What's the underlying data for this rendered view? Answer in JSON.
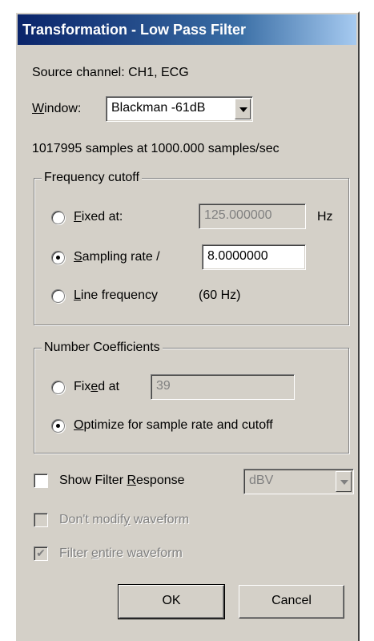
{
  "window": {
    "title": "Transformation - Low Pass Filter"
  },
  "source": {
    "label": "Source channel:",
    "value": "CH1, ECG"
  },
  "window_select": {
    "label_prefix": "",
    "label_ul": "W",
    "label_rest": "indow:",
    "value": "Blackman -61dB"
  },
  "samples_info": "1017995 samples at 1000.000 samples/sec",
  "frequency_cutoff": {
    "legend": "Frequency cutoff",
    "options": [
      {
        "ul": "F",
        "rest": "ixed at:",
        "selected": false
      },
      {
        "ul": "S",
        "rest": "ampling rate /",
        "selected": true
      },
      {
        "ul": "L",
        "rest": "ine frequency",
        "selected": false
      }
    ],
    "fixed_value": "125.000000",
    "fixed_unit": "Hz",
    "sampling_divisor": "8.0000000",
    "line_freq_note": "(60 Hz)"
  },
  "number_coefficients": {
    "legend": "Number Coefficients",
    "fixed": {
      "pre": "Fix",
      "ul": "e",
      "post": "d at",
      "selected": false
    },
    "fixed_value": "39",
    "optimize": {
      "ul": "O",
      "rest": "ptimize for sample rate and cutoff",
      "selected": true
    }
  },
  "show_response": {
    "pre": "Show Filter ",
    "ul": "R",
    "post": "esponse",
    "checked": false,
    "unit_select": "dBV"
  },
  "dont_modify": {
    "pre": "Don't modif",
    "ul": "y",
    "post": " waveform",
    "checked": false,
    "enabled": false
  },
  "filter_entire": {
    "pre": "Filter ",
    "ul": "e",
    "post": "ntire waveform",
    "checked": true,
    "enabled": false
  },
  "buttons": {
    "ok": "OK",
    "cancel": "Cancel"
  }
}
